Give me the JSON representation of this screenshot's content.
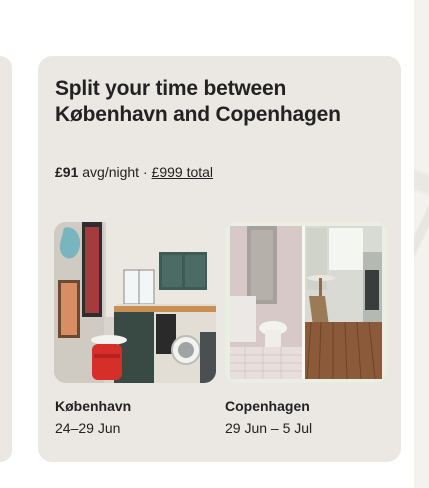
{
  "card": {
    "title": "Split your time between København and Copenhagen",
    "price": {
      "amount": "£91",
      "unit": "avg/night",
      "separator": "·",
      "total": "£999 total"
    },
    "stays": [
      {
        "city": "København",
        "dates": "24–29 Jun",
        "photo_icon": "kitchen-photo"
      },
      {
        "city": "Copenhagen",
        "dates": "29 Jun – 5 Jul",
        "photo_icon": "bathroom-bedroom-photo"
      }
    ]
  },
  "colors": {
    "card_background": "#ebe8e3",
    "text": "#222222",
    "page_background": "#ffffff"
  }
}
